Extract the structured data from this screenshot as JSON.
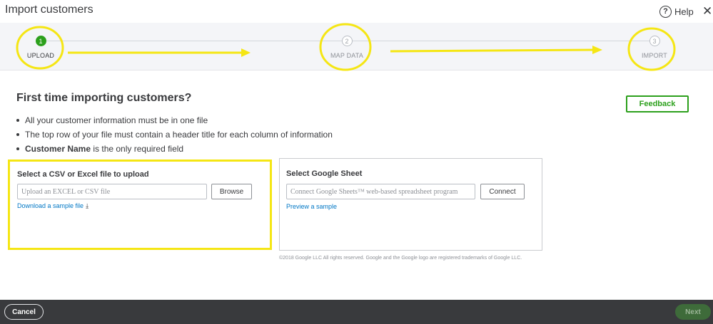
{
  "header": {
    "title": "Import customers",
    "help_label": "Help",
    "help_glyph": "?",
    "close_glyph": "✕"
  },
  "stepper": {
    "steps": [
      {
        "number": "1",
        "label": "UPLOAD",
        "state": "active"
      },
      {
        "number": "2",
        "label": "MAP DATA",
        "state": "idle"
      },
      {
        "number": "3",
        "label": "IMPORT",
        "state": "idle"
      }
    ]
  },
  "main": {
    "heading": "First time importing customers?",
    "feedback_label": "Feedback",
    "bullets": {
      "one": "All your customer information must be in one file",
      "two": "The top row of your file must contain a header title for each column of information",
      "three_bold": "Customer Name",
      "three_rest": " is the only required field"
    }
  },
  "upload_panel": {
    "title": "Select a CSV or Excel file to upload",
    "input_placeholder": "Upload an EXCEL or CSV file",
    "browse_label": "Browse",
    "sample_link": "Download a sample file"
  },
  "google_panel": {
    "title": "Select Google Sheet",
    "input_placeholder": "Connect Google Sheets™ web-based spreadsheet program",
    "connect_label": "Connect",
    "sample_link": "Preview a sample",
    "legal": "©2018 Google LLC All rights reserved. Google and the Google logo are registered trademarks of Google LLC."
  },
  "footer": {
    "cancel_label": "Cancel",
    "next_label": "Next"
  },
  "colors": {
    "brand_green": "#2ca01c",
    "link_blue": "#0077c5",
    "annotation_yellow": "#f5e614",
    "footer_bg": "#393a3d"
  },
  "icons": {
    "help": "help-circle-icon",
    "close": "close-icon",
    "download": "download-icon"
  }
}
